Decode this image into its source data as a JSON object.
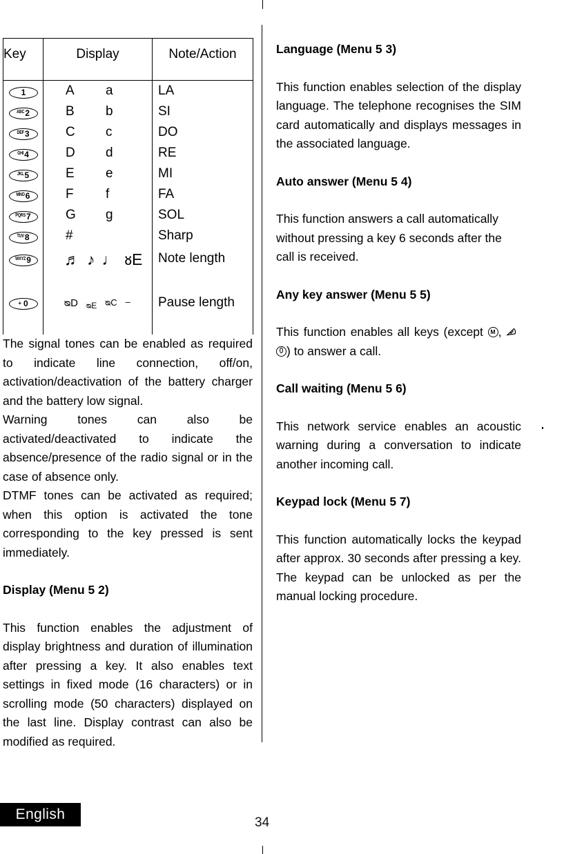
{
  "page": {
    "number": "34",
    "language_tab": "English"
  },
  "table": {
    "headers": {
      "key": "Key",
      "display": "Display",
      "note_action": "Note/Action"
    },
    "rows": [
      {
        "key_prefix": "",
        "key_num": "1",
        "upper": "A",
        "lower": "a",
        "note": "LA"
      },
      {
        "key_prefix": "ABC",
        "key_num": "2",
        "upper": "B",
        "lower": "b",
        "note": "SI"
      },
      {
        "key_prefix": "DEF",
        "key_num": "3",
        "upper": "C",
        "lower": "c",
        "note": "DO"
      },
      {
        "key_prefix": "GHI",
        "key_num": "4",
        "upper": "D",
        "lower": "d",
        "note": "RE"
      },
      {
        "key_prefix": "JKL",
        "key_num": "5",
        "upper": "E",
        "lower": "e",
        "note": "MI"
      },
      {
        "key_prefix": "MNO",
        "key_num": "6",
        "upper": "F",
        "lower": "f",
        "note": "FA"
      },
      {
        "key_prefix": "PQRS",
        "key_num": "7",
        "upper": "G",
        "lower": "g",
        "note": "SOL"
      },
      {
        "key_prefix": "TUV",
        "key_num": "8",
        "upper": "#",
        "lower": "",
        "note": "Sharp"
      }
    ],
    "note_length_row": {
      "key_prefix": "WXYZ",
      "key_num": "9",
      "glyphs": [
        "♬",
        "♪",
        "♩",
        "ᴕE"
      ],
      "note": "Note length"
    },
    "pause_length_row": {
      "key_prefix": "+",
      "key_num": "0",
      "glyphs": [
        "ᴓD",
        "ᴓE",
        "ᴓC",
        "–"
      ],
      "note": "Pause length"
    }
  },
  "left_column": {
    "tones_paragraphs": [
      "The signal tones can be enabled as required to indicate line connection, off/on, activation/deactivation of the battery charger and the battery low signal.",
      "Warning tones can also be activated/deactivated to indicate the absence/presence of the radio signal or in the case of absence only.",
      "DTMF tones can be activated as required; when this option is activated the tone corresponding to the key pressed is sent immediately."
    ],
    "display_section": {
      "heading": "Display (Menu 5 2)",
      "body": "This function enables the adjustment of display brightness and duration of illumination after pressing a key. It also enables text settings in fixed mode (16 characters) or in scrolling mode (50 characters) displayed on the last line. Display contrast can also be modified as required."
    }
  },
  "right_column": {
    "language_section": {
      "heading": "Language  (Menu 5 3)",
      "body": "This function enables selection of the display language. The telephone recognises the SIM card automatically and displays messages in the associated language."
    },
    "auto_answer_section": {
      "heading": "Auto answer  (Menu 5 4)",
      "body": "This function answers a call automatically without pressing a key 6 seconds after the call is received."
    },
    "any_key_answer_section": {
      "heading": "Any key answer  (Menu 5 5)",
      "body_start": "This function enables all keys (except ",
      "body_mid": ", ",
      "body_end": ") to answer a call.",
      "icons": [
        "menu-key-icon",
        "send-key-icon",
        "power-key-icon"
      ]
    },
    "call_waiting_section": {
      "heading": "Call waiting (Menu 5 6)",
      "body": "This network service enables an acoustic warning during a conversation to indicate another incoming call."
    },
    "keypad_lock_section": {
      "heading": "Keypad lock (Menu 5 7)",
      "body": "This function automatically locks the keypad after approx. 30 seconds after pressing a key. The keypad can be unlocked as per the manual locking procedure."
    }
  }
}
